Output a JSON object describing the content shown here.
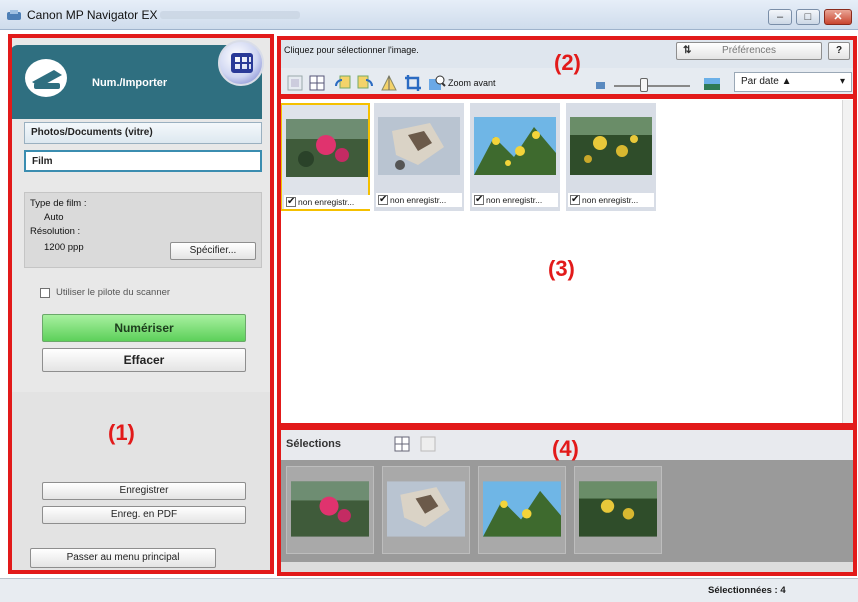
{
  "window": {
    "title": "Canon MP Navigator EX",
    "controls": [
      "minimize",
      "maximize",
      "close"
    ]
  },
  "left_panel": {
    "mode_tab": "Num./Importer",
    "sources": [
      "Photos/Documents (vitre)",
      "Film"
    ],
    "selected_source": "Film",
    "film_type_label": "Type de film :",
    "film_type_value": "Auto",
    "resolution_label": "Résolution :",
    "resolution_value": "1200 ppp",
    "specify_button": "Spécifier...",
    "use_driver_label": "Utiliser le pilote du scanner",
    "scan_button": "Numériser",
    "clear_button": "Effacer",
    "save_button": "Enregistrer",
    "save_pdf_button": "Enreg. en PDF",
    "main_menu_button": "Passer au menu principal"
  },
  "top": {
    "hint": "Cliquez pour sélectionner l'image.",
    "preferences_button": "Préférences",
    "help_button": "?",
    "zoom_label": "Zoom avant",
    "sort_value": "Par date ▲"
  },
  "thumbnails": [
    {
      "caption": "non enregistr...",
      "checked": true,
      "selected": true,
      "scene": "red-flower"
    },
    {
      "caption": "non enregistr...",
      "checked": true,
      "selected": false,
      "scene": "cat"
    },
    {
      "caption": "non enregistr...",
      "checked": true,
      "selected": false,
      "scene": "yellow-flowers-sky"
    },
    {
      "caption": "non enregistr...",
      "checked": true,
      "selected": false,
      "scene": "yellow-flowers-dark"
    }
  ],
  "selections": {
    "title": "Sélections",
    "count": 4
  },
  "status": {
    "selected_text": "Sélectionnées : 4"
  },
  "regions": [
    "(1)",
    "(2)",
    "(3)",
    "(4)"
  ],
  "colors": {
    "highlight": "#e21a1a",
    "accent": "#2f6f80",
    "scan_green": "#5dd05a"
  }
}
